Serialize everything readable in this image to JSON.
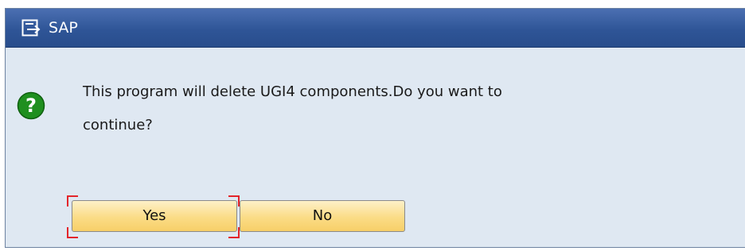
{
  "window": {
    "title": "SAP",
    "title_icon": "sap-window-icon"
  },
  "message": {
    "icon": "question-icon",
    "text": "This program will delete UGI4 components.Do you want to continue?"
  },
  "buttons": {
    "yes_label": "Yes",
    "no_label": "No"
  },
  "colors": {
    "titlebar": "#2f5597",
    "dialog_background": "#dfe8f2",
    "button": "#fbdc86",
    "focus_marker": "#e3252b",
    "question_icon": "#1f8f1f"
  }
}
